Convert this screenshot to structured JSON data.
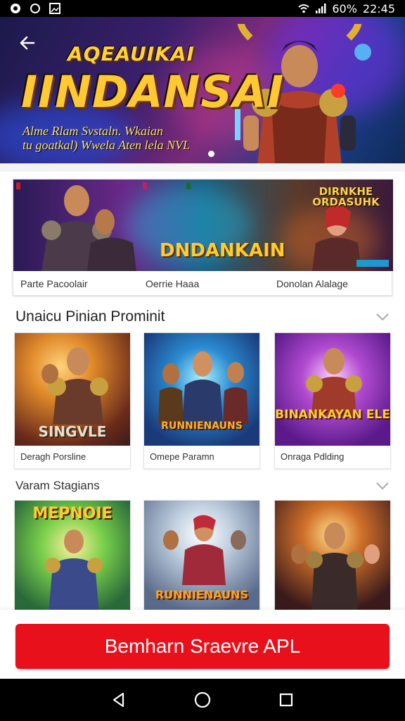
{
  "status_bar": {
    "battery": "60%",
    "time": "22:45",
    "icons": [
      "record-icon",
      "circle-icon",
      "image-icon",
      "wifi-icon",
      "signal-icon"
    ]
  },
  "hero": {
    "title_line1": "AQEAUIKAI",
    "title_line2": "IINDANSAI",
    "subtitle_line1": "Alme Rlam Svstaln. Wkaian",
    "subtitle_line2": "tu goatkal) Wwela Aten lela NVL",
    "back_icon": "arrow-left-icon"
  },
  "banner": {
    "logo_main": "DNDANKAIN",
    "logo_side": "DIRNKHE ORDASUHK",
    "labels": [
      "Parte Pacoolair",
      "Oerrie Haaa",
      "Donolan Alalage"
    ]
  },
  "section1": {
    "title": "Unaicu Pinian Prominit",
    "chevron_icon": "chevron-down-icon",
    "cards": [
      {
        "label": "Deragh Porsline",
        "logo": "SINGVLE"
      },
      {
        "label": "Omepe Paramn",
        "logo": "RUNNIENAUNS"
      },
      {
        "label": "Onraga Pdlding",
        "logo": "BINANKAYAN ELE"
      }
    ]
  },
  "section2": {
    "title": "Varam Stagians",
    "chevron_icon": "chevron-down-icon",
    "cards": [
      {
        "logo": "MEPNOIE"
      },
      {
        "logo": "RUNNIENAUNS"
      },
      {
        "logo": ""
      }
    ]
  },
  "cta": {
    "label": "Bemharn Sraevre APL"
  },
  "nav": {
    "icons": [
      "back-triangle-icon",
      "home-circle-icon",
      "recents-square-icon"
    ]
  },
  "colors": {
    "cta": "#e8101b",
    "logo_gold": "#ffc934",
    "status_bar": "#000000"
  }
}
